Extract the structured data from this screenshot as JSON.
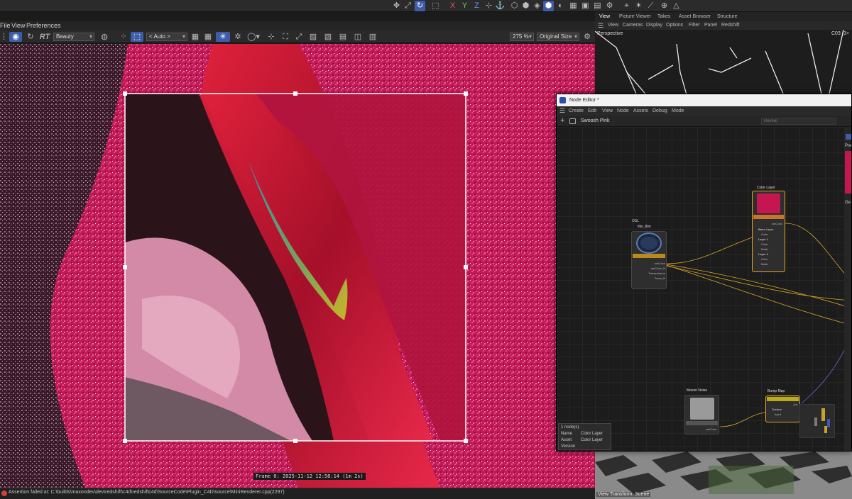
{
  "top_toolbar": {
    "axis_x": "X",
    "axis_y": "Y",
    "axis_z": "Z"
  },
  "picture_viewer": {
    "menu": [
      "File",
      "View",
      "Preferences"
    ],
    "rt_label": "RT",
    "layer_select": "Beauty",
    "filter_select": "< Auto >",
    "zoom": "275 %",
    "size_select": "Original Size",
    "frame_info": "Frame 0: 2025-11-12 12:58:14 (1m 2s)",
    "status": "Assertion failed at: C:\\builds\\maxondev\\dev\\redshift\\c4d\\redshiftc4d\\SourceCode\\Plugin_C4D\\source\\MiniRenderer.cpp(2297)"
  },
  "viewport": {
    "tabs": [
      "View",
      "Picture Viewer",
      "Takes",
      "Asset Browser",
      "Structure"
    ],
    "menu": [
      "View",
      "Cameras",
      "Display",
      "Options",
      "Filter",
      "Panel",
      "Redshift"
    ],
    "camera_label": "Perspective",
    "camera_name": "C03 (3+",
    "view_transform": "View Transform: Scene"
  },
  "node_editor": {
    "title": "Node Editor *",
    "menu": [
      "Create",
      "Edit",
      "View",
      "Node",
      "Assets",
      "Debug",
      "Mode"
    ],
    "path": "Swoosh Pink",
    "search_placeholder": "Reveal",
    "nodes": {
      "thin_film": {
        "category": "OSL",
        "name": "thin_film",
        "ports": [
          "outColor",
          "outColor_N",
          "Transmission",
          "Trans_N"
        ]
      },
      "color_layer": {
        "name": "Color Layer",
        "out_port": "outColor",
        "rows": [
          "Base Layer",
          "Color",
          "Layer 1",
          "Color",
          "Mask",
          "Layer 2",
          "Color",
          "Mask"
        ]
      },
      "maxon_noise": {
        "name": "Maxon Noise",
        "out_port": "outColor"
      },
      "bump_map": {
        "name": "Bump Map",
        "out_port": "out",
        "rows": [
          "Texture",
          "Input"
        ]
      }
    },
    "info": {
      "count": "1 node(s)",
      "name_label": "Name",
      "name_value": "Color Layer",
      "asset_label": "Asset",
      "asset_value": "Color Layer",
      "version_label": "Version"
    },
    "side_panel_labels": [
      "Pre",
      "Ge"
    ]
  },
  "colors": {
    "accent_blue": "#3d5da8",
    "wire_yellow": "#d4a52a",
    "render_pink": "#c41752",
    "selection_orange": "#e6a52a"
  }
}
